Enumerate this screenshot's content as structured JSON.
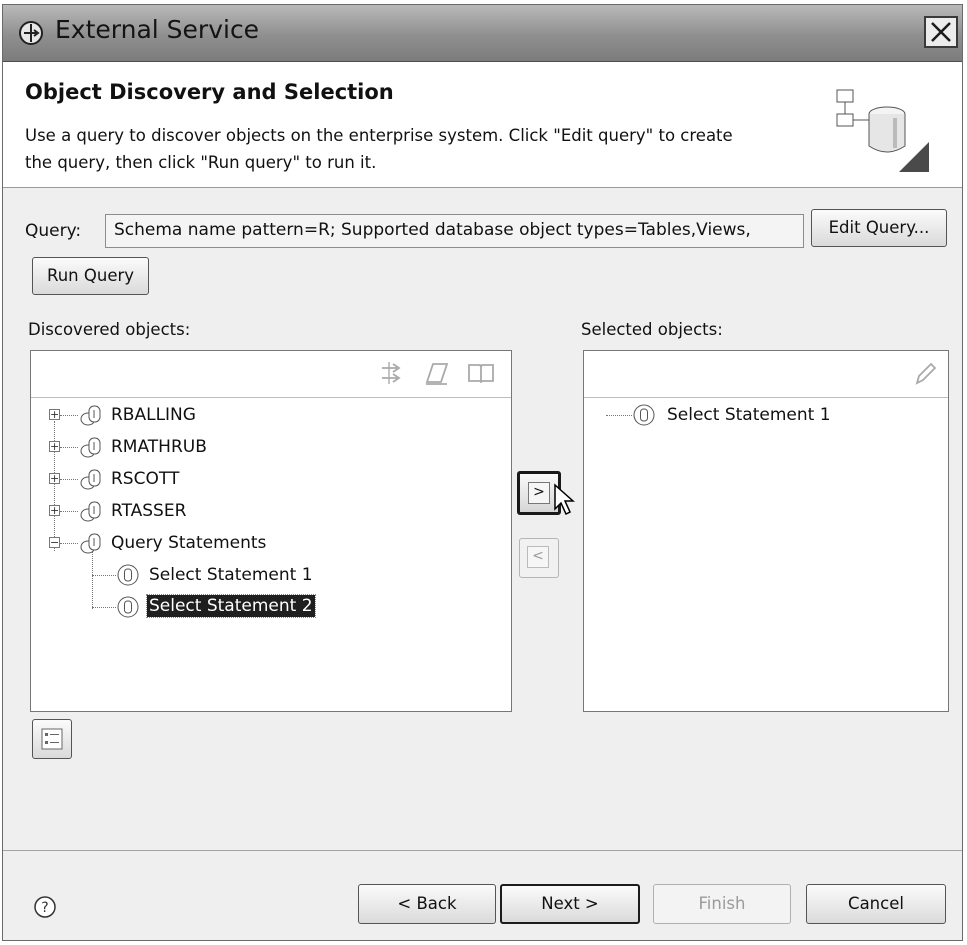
{
  "window": {
    "title": "External Service",
    "close_icon": "close-x-icon",
    "app_icon": "external-service-icon"
  },
  "banner": {
    "title": "Object Discovery and Selection",
    "description_line1": "Use a query to discover objects on the enterprise system.  Click \"Edit query\" to create",
    "description_line2": "the query, then click \"Run query\" to run it.",
    "icon": "database-diagram-icon"
  },
  "query": {
    "label": "Query:",
    "value": "Schema name pattern=R; Supported database object types=Tables,Views,",
    "edit_button": "Edit Query...",
    "run_button": "Run Query"
  },
  "discovered": {
    "label": "Discovered objects:",
    "toolbar_icons": [
      "filter-icon",
      "edit-icon",
      "book-icon"
    ],
    "items": [
      {
        "label": "RBALLING",
        "expanded": false
      },
      {
        "label": "RMATHRUB",
        "expanded": false
      },
      {
        "label": "RSCOTT",
        "expanded": false
      },
      {
        "label": "RTASSER",
        "expanded": false
      },
      {
        "label": "Query Statements",
        "expanded": true
      },
      {
        "label": "Select Statement 1"
      },
      {
        "label": "Select Statement 2",
        "selected": true
      }
    ]
  },
  "selected": {
    "label": "Selected objects:",
    "toolbar_icon": "edit-icon",
    "items": [
      {
        "label": "Select Statement 1"
      }
    ]
  },
  "transfer": {
    "add_symbol": ">",
    "remove_symbol": "<"
  },
  "properties_button_icon": "properties-list-icon",
  "footer": {
    "help_symbol": "?",
    "back_button": "< Back",
    "next_button": "Next >",
    "finish_button": "Finish",
    "cancel_button": "Cancel"
  }
}
